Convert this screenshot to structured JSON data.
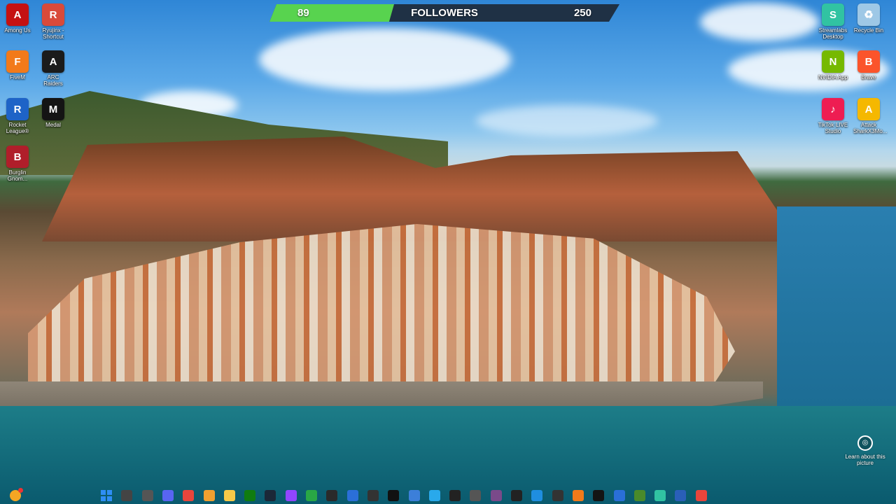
{
  "followers_bar": {
    "current": "89",
    "label": "FOLLOWERS",
    "goal": "250",
    "progress": 0.356
  },
  "desktop_icons_left": [
    {
      "label": "Among Us",
      "icon": "among-us-icon",
      "color": "#c51111",
      "glyph": "A"
    },
    {
      "label": "Ryujinx - Shortcut",
      "icon": "ryujinx-icon",
      "color": "#d94a3a",
      "glyph": "R"
    },
    {
      "label": "FiveM",
      "icon": "fivem-icon",
      "color": "#f27a1a",
      "glyph": "F"
    },
    {
      "label": "ARC Raiders",
      "icon": "arc-raiders-icon",
      "color": "#1b1b1b",
      "glyph": "A"
    },
    {
      "label": "Rocket League®",
      "icon": "rocket-league-icon",
      "color": "#1e63c7",
      "glyph": "R"
    },
    {
      "label": "Medal",
      "icon": "medal-icon",
      "color": "#141414",
      "glyph": "M"
    },
    {
      "label": "Burglin Gnom...",
      "icon": "burglin-gnomes-icon",
      "color": "#b01e2a",
      "glyph": "B"
    }
  ],
  "desktop_icons_right": [
    {
      "label": "Streamlabs Desktop",
      "icon": "streamlabs-icon",
      "color": "#31c3a2",
      "glyph": "S"
    },
    {
      "label": "Recycle Bin",
      "icon": "recycle-bin-icon",
      "color": "#9ec8e6",
      "glyph": "♻"
    },
    {
      "label": "NVIDIA App",
      "icon": "nvidia-icon",
      "color": "#76b900",
      "glyph": "N"
    },
    {
      "label": "Brave",
      "icon": "brave-icon",
      "color": "#fb542b",
      "glyph": "B"
    },
    {
      "label": "TikTok LIVE Studio",
      "icon": "tiktok-live-icon",
      "color": "#ee1d52",
      "glyph": "♪"
    },
    {
      "label": "Attack SharkX3Mo...",
      "icon": "attack-shark-icon",
      "color": "#f5b800",
      "glyph": "A"
    }
  ],
  "learn_picture": {
    "label": "Learn about this picture",
    "icon": "camera-icon"
  },
  "taskbar": [
    {
      "icon": "chrome-profile-icon",
      "color": "#f5a623"
    },
    {
      "icon": "start-icon",
      "color": "#2e8ef5"
    },
    {
      "icon": "search-icon",
      "color": "#444"
    },
    {
      "icon": "task-view-icon",
      "color": "#555"
    },
    {
      "icon": "discord-icon",
      "color": "#5865f2"
    },
    {
      "icon": "chrome-icon",
      "color": "#e8453c"
    },
    {
      "icon": "game-app-icon",
      "color": "#f0a030"
    },
    {
      "icon": "file-explorer-icon",
      "color": "#f7c948"
    },
    {
      "icon": "xbox-icon",
      "color": "#107c10"
    },
    {
      "icon": "steam-icon",
      "color": "#1b2838"
    },
    {
      "icon": "twitch-icon",
      "color": "#9146ff"
    },
    {
      "icon": "b-app-icon",
      "color": "#29a745"
    },
    {
      "icon": "epic-games-icon",
      "color": "#2a2a2a"
    },
    {
      "icon": "browser-icon",
      "color": "#2b6fd8"
    },
    {
      "icon": "obs-icon",
      "color": "#333"
    },
    {
      "icon": "tiktok-icon",
      "color": "#111"
    },
    {
      "icon": "app-blue-icon",
      "color": "#3c7fd9"
    },
    {
      "icon": "telegram-icon",
      "color": "#29a9eb"
    },
    {
      "icon": "capcut-icon",
      "color": "#222"
    },
    {
      "icon": "network-icon",
      "color": "#555"
    },
    {
      "icon": "game-icon-2",
      "color": "#7a4a8a"
    },
    {
      "icon": "circle-app-icon",
      "color": "#222"
    },
    {
      "icon": "edge-icon",
      "color": "#1f8ee0"
    },
    {
      "icon": "terminal-icon",
      "color": "#333"
    },
    {
      "icon": "fivem-icon",
      "color": "#f27a1a"
    },
    {
      "icon": "medal-icon",
      "color": "#141414"
    },
    {
      "icon": "settings-icon",
      "color": "#2a6fd8"
    },
    {
      "icon": "minecraft-icon",
      "color": "#4a8a2a"
    },
    {
      "icon": "streamlabs-icon",
      "color": "#31c3a2"
    },
    {
      "icon": "shield-icon",
      "color": "#2a5fb8"
    },
    {
      "icon": "chrome-icon",
      "color": "#e8453c"
    }
  ]
}
